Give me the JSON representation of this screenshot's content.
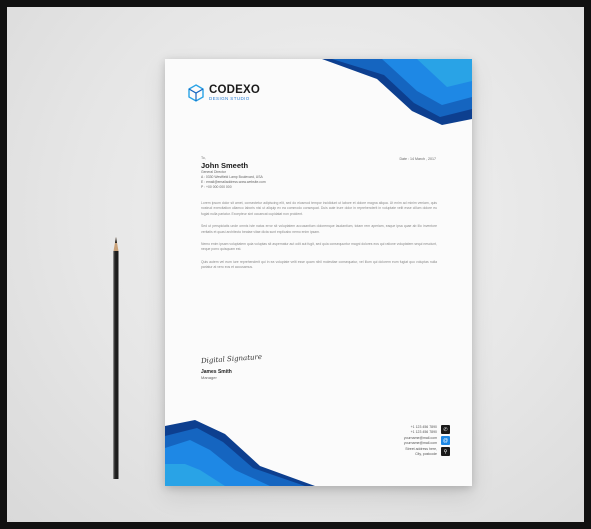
{
  "brand": {
    "name": "CODEXO",
    "tagline": "DESIGN STUDIO",
    "colors": {
      "primary": "#1565c0",
      "light": "#29a3e6",
      "dark": "#0d3f8f"
    }
  },
  "letter": {
    "date": "Date : 14 March , 2017",
    "to_label": "To,",
    "recipient": {
      "name": "John Smeeth",
      "title": "General Director",
      "address": "A : 0330 Westfield Lamp Boulevard, USA",
      "email": "E : email@emailaddress.www.website.com",
      "phone": "P : +00 000 000 000"
    },
    "paragraphs": [
      "Lorem ipsum dolor sit amet, consectetur adipiscing elit, sed do eiusmod tempor incididunt ut labore et dolore magna aliqua. Ut enim ad minim veniam, quis nostrud exercitation ullamco laboris nisi ut aliquip ex ea commodo consequat. Duis aute irure dolor in reprehenderit in voluptate velit esse cillum dolore eu fugiat nulla pariatur. Excepteur sint occaecat cupidatat non proident.",
      "Sed ut perspiciatis unde omnis iste natus error sit voluptatem accusantium doloremque laudantium, totam rem aperiam, eaque ipsa quae ab illo inventore veritatis et quasi architecto beatae vitae dicta sunt explicabo nemo enim ipsam.",
      "Nemo enim ipsam voluptatem quia voluptas sit aspernatur aut odit aut fugit, sed quia consequuntur magni dolores eos qui ratione voluptatem sequi nesciunt, neque porro quisquam est.",
      "Quis autem vel eum iure reprehenderit qui in ea voluptate velit esse quam nihil molestiae consequatur, vel illum qui dolorem eum fugiat quo voluptas nulla pariatur at vero eos et accusamus."
    ],
    "signature": "Digital Signature",
    "sender": {
      "name": "James Smith",
      "role": "Manager"
    }
  },
  "contacts": [
    {
      "lines": [
        "+1 123 456 7890",
        "+1 123 456 7890"
      ],
      "icon": "phone-icon",
      "glyph": "✆"
    },
    {
      "lines": [
        "yourname@mail.com",
        "yourname@mail.com"
      ],
      "icon": "email-icon",
      "glyph": "@"
    },
    {
      "lines": [
        "Street address here,",
        "City, postcode"
      ],
      "icon": "location-icon",
      "glyph": "⚲"
    }
  ]
}
